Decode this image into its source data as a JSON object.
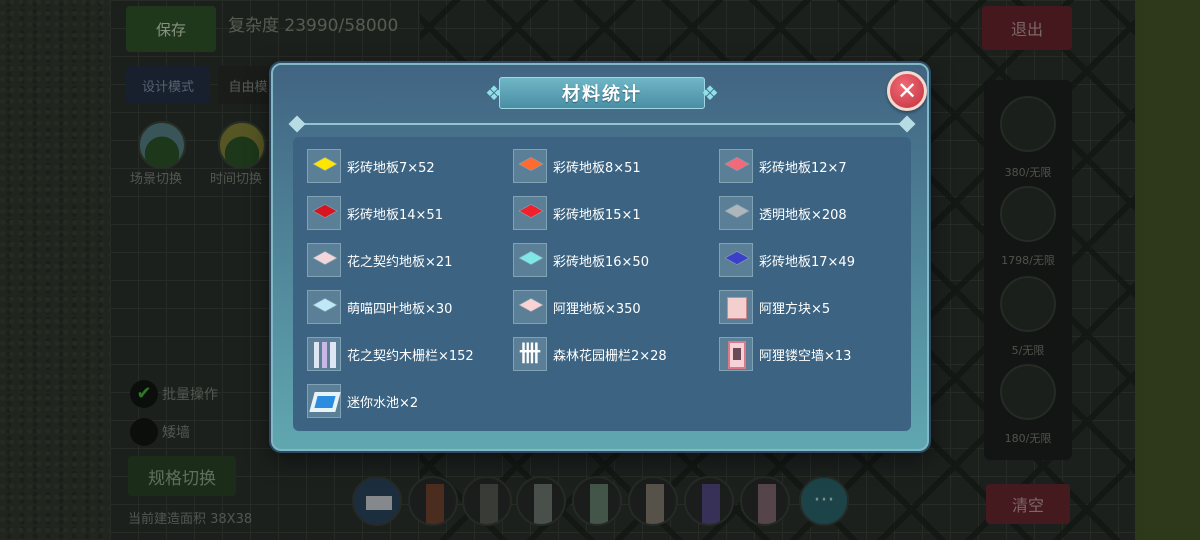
{
  "hud": {
    "save": "保存",
    "complexity": "复杂度 23990/58000",
    "design_mode": "设计模式",
    "free_mode": "自由模",
    "scene_switch": "场景切换",
    "time_switch": "时间切换",
    "batch_op": "批量操作",
    "wall": "矮墙",
    "spec_switch": "规格切换",
    "build_area": "当前建造面积 38X38",
    "exit": "退出",
    "clear": "清空",
    "side_items": [
      "380/无限",
      "1798/无限",
      "5/无限",
      "180/无限"
    ]
  },
  "modal": {
    "title": "材料统计",
    "close_glyph": "✕",
    "materials": [
      {
        "label": "彩砖地板7×52",
        "icon": "tile-icon",
        "color": "#ffe600"
      },
      {
        "label": "彩砖地板8×51",
        "icon": "tile-icon",
        "color": "#ff6a2e"
      },
      {
        "label": "彩砖地板12×7",
        "icon": "tile-icon",
        "color": "#f26a7a"
      },
      {
        "label": "彩砖地板14×51",
        "icon": "tile-icon",
        "color": "#d8141f"
      },
      {
        "label": "彩砖地板15×1",
        "icon": "tile-icon",
        "color": "#f2202a"
      },
      {
        "label": "透明地板×208",
        "icon": "tile-icon",
        "color": "#aeb6bc"
      },
      {
        "label": "花之契约地板×21",
        "icon": "flower-tile-icon",
        "color": "#f3d6dc"
      },
      {
        "label": "彩砖地板16×50",
        "icon": "tile-icon",
        "color": "#7fe8e6"
      },
      {
        "label": "彩砖地板17×49",
        "icon": "tile-icon",
        "color": "#3c3fc9"
      },
      {
        "label": "萌喵四叶地板×30",
        "icon": "clover-tile-icon",
        "color": "#bfe8f6"
      },
      {
        "label": "阿狸地板×350",
        "icon": "ali-tile-icon",
        "color": "#f9d2d4"
      },
      {
        "label": "阿狸方块×5",
        "icon": "ali-cube-icon",
        "color": "#f3cfd0"
      },
      {
        "label": "花之契约木栅栏×152",
        "icon": "wood-fence-icon",
        "color": "#dfe6f3"
      },
      {
        "label": "森林花园栅栏2×28",
        "icon": "garden-fence-icon",
        "color": "#ffffff"
      },
      {
        "label": "阿狸镂空墙×13",
        "icon": "ali-wall-icon",
        "color": "#f7d1d7"
      },
      {
        "label": "迷你水池×2",
        "icon": "mini-pool-icon",
        "color": "#2a8de0"
      }
    ]
  }
}
